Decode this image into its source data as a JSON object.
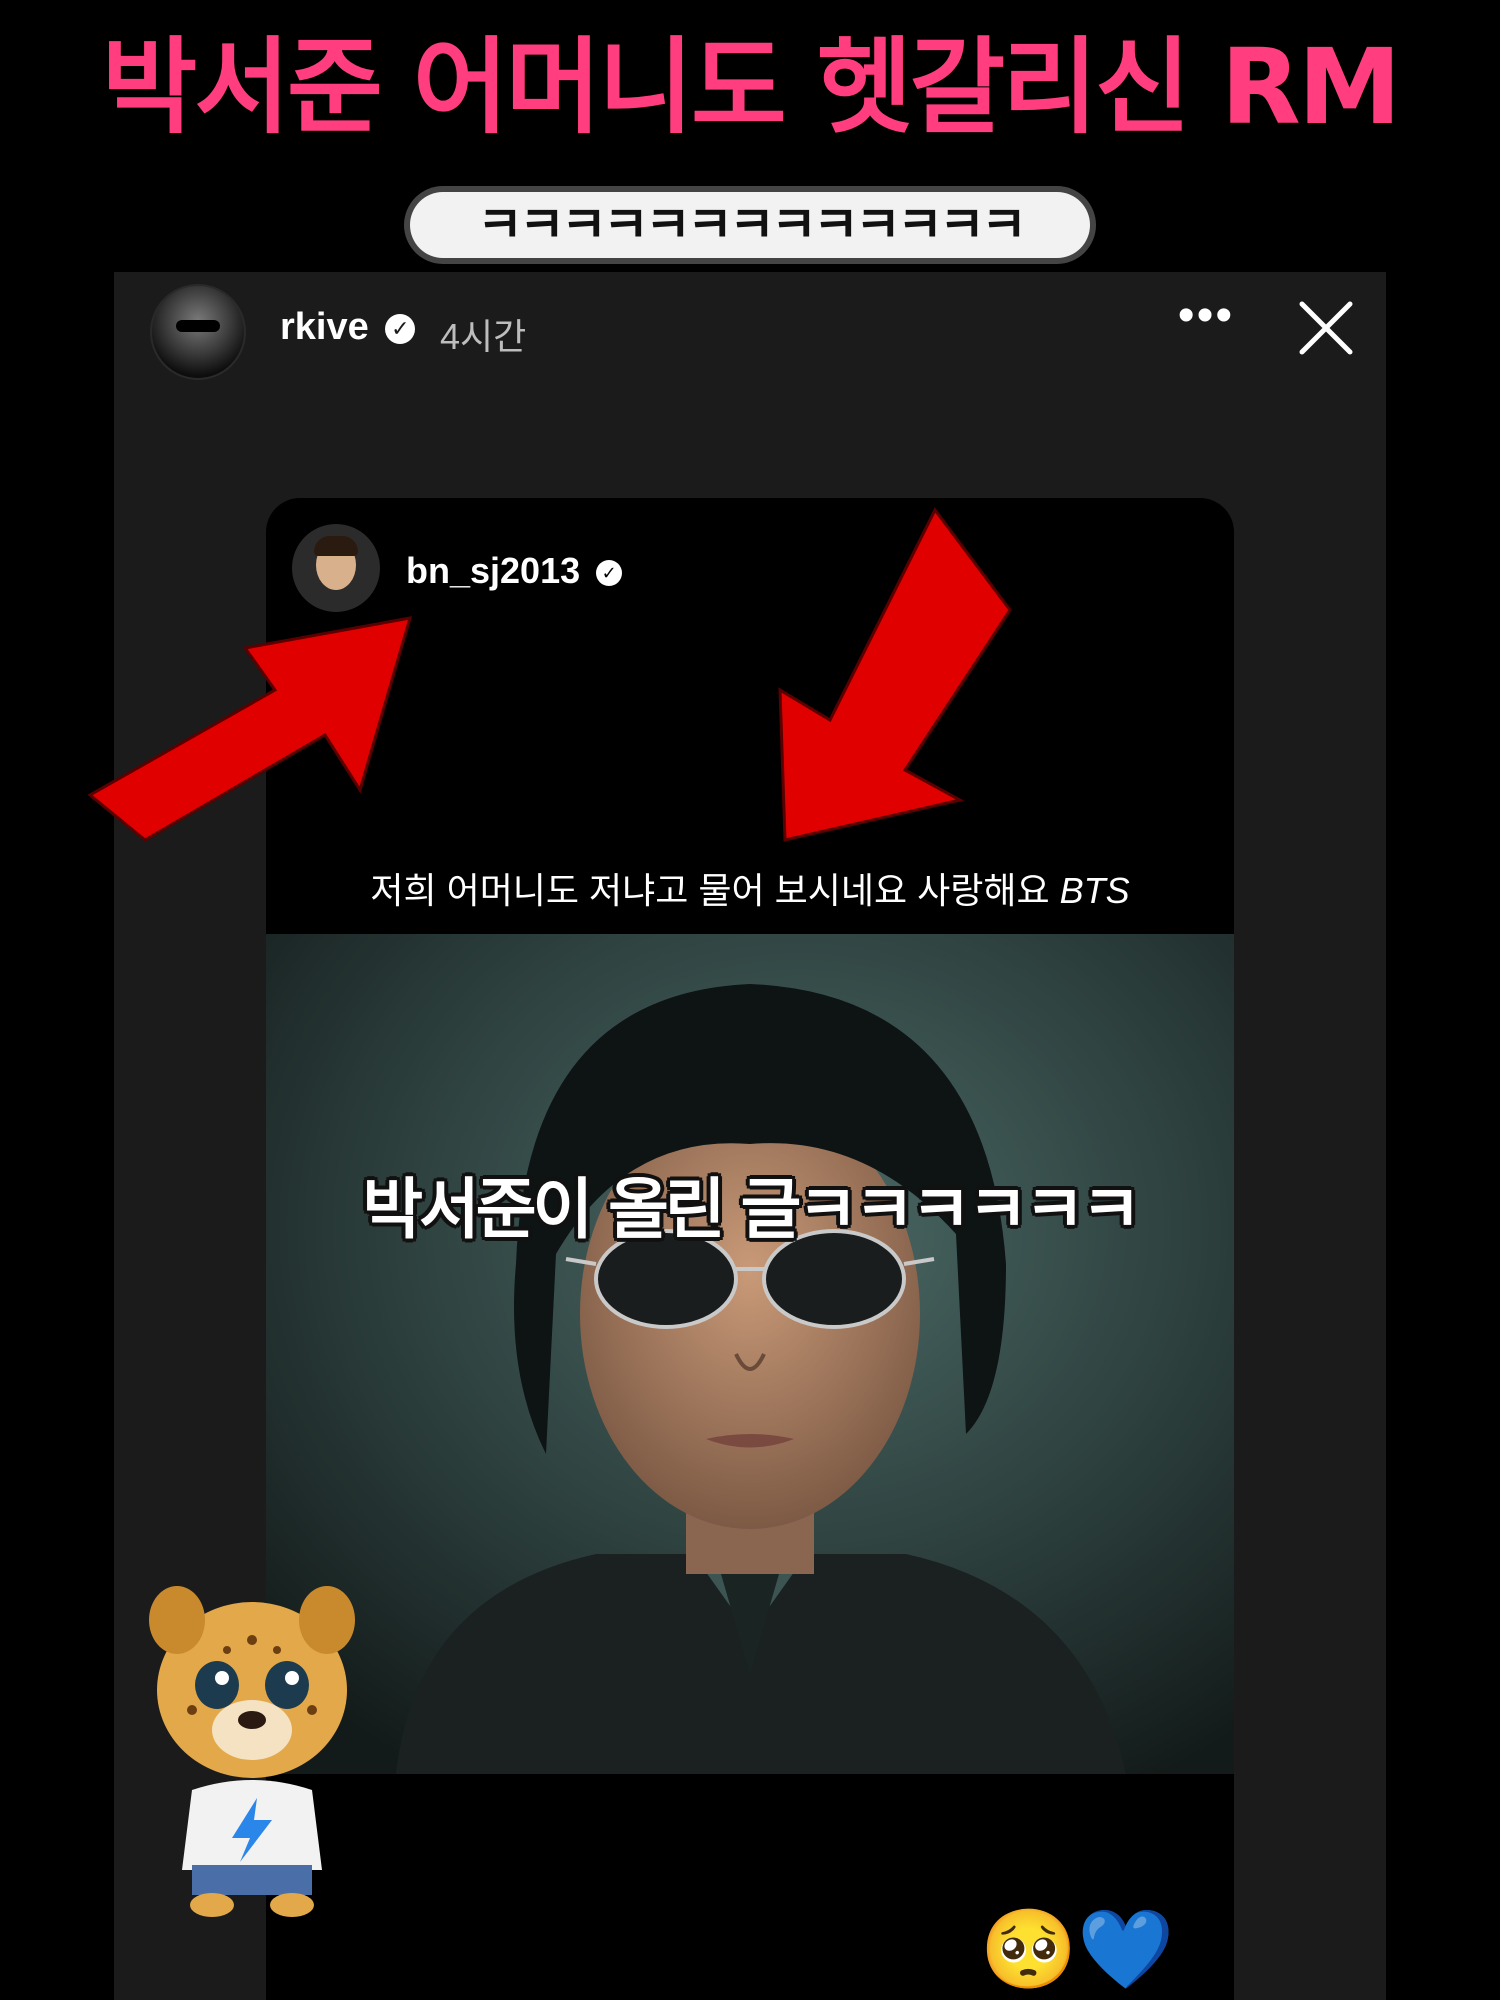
{
  "headline": "박서준 어머니도 헷갈리신 RM",
  "subtitle": "ㅋㅋㅋㅋㅋㅋㅋㅋㅋㅋㅋㅋㅋ",
  "story": {
    "username": "rkive",
    "time": "4시간",
    "more_label": "•••",
    "verified_glyph": "✓"
  },
  "post": {
    "username": "bn_sj2013",
    "caption": "저희 어머니도 저냐고 물어 보시네요 사랑해요",
    "caption_tag": "BTS"
  },
  "overlay_text": "박서준이 올린 글ㅋㅋㅋㅋㅋㅋ",
  "emojis": "🥺💙",
  "colors": {
    "headline": "#ff3d7f",
    "arrow": "#e00000"
  }
}
